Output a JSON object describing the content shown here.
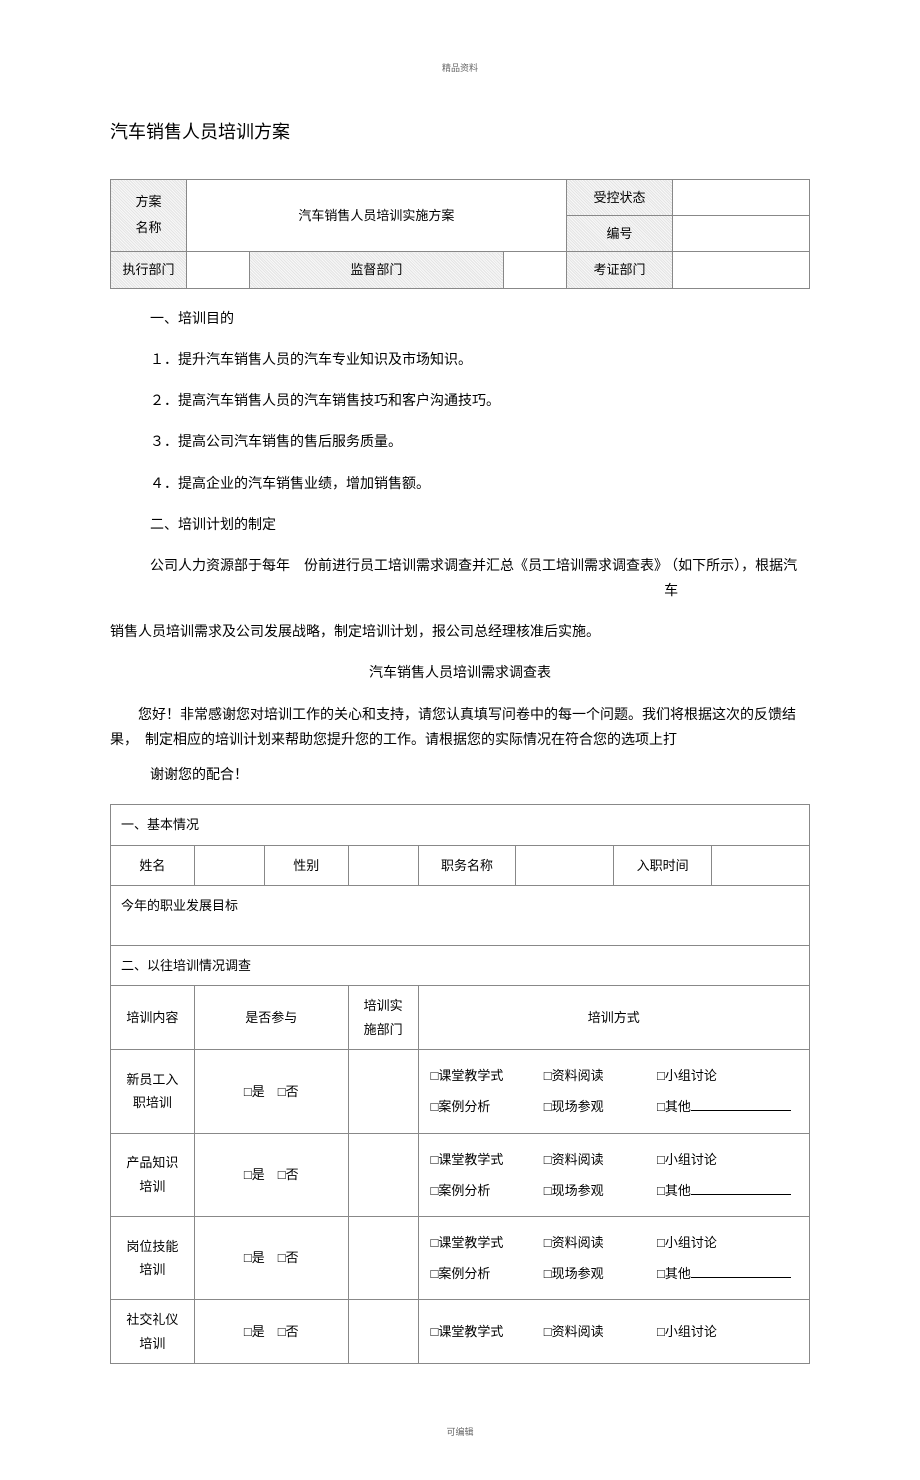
{
  "header_small": "精品资料",
  "title": "汽车销售人员培训方案",
  "header_table": {
    "plan_name_label": "方案\n名称",
    "plan_name_value": "汽车销售人员培训实施方案",
    "status_label": "受控状态",
    "status_value": "",
    "id_label": "编号",
    "id_value": "",
    "exec_dept_label": "执行部门",
    "exec_dept_value": "",
    "supervise_dept_label": "监督部门",
    "supervise_dept_value": "",
    "audit_dept_label": "考证部门",
    "audit_dept_value": ""
  },
  "sec1": {
    "heading": "一、培训目的",
    "p1": "１．提升汽车销售人员的汽车专业知识及市场知识。",
    "p2": "２．提高汽车销售人员的汽车销售技巧和客户沟通技巧。",
    "p3": "３．提高公司汽车销售的售后服务质量。",
    "p4": "４．提高企业的汽车销售业绩，增加销售额。"
  },
  "sec2": {
    "heading": "二、培训计划的制定",
    "p1_a": "公司人力资源部于每年　份前进行员工培训需求调查并汇总《员工培训需求调查表》",
    "p1_b": "（如下所示），根据汽车",
    "p2": "销售人员培训需求及公司发展战略，制定培训计划，报公司总经理核准后实施。",
    "survey_title": "汽车销售人员培训需求调查表",
    "intro1": "您好！非常感谢您对培训工作的关心和支持，请您认真填写问卷中的每一个问题。我们将根据这次的反馈结果，　制定相应的培训计划来帮助您提升您的工作。请根据您的实际情况在符合您的选项上打",
    "thanks": "谢谢您的配合！"
  },
  "survey": {
    "sec1_heading": "一、基本情况",
    "name_label": "姓名",
    "name_value": "",
    "gender_label": "性别",
    "gender_value": "",
    "position_label": "职务名称",
    "position_value": "",
    "entry_label": "入职时间",
    "entry_value": "",
    "goal_label": "今年的职业发展目标",
    "goal_value": "",
    "sec2_heading": "二、以往培训情况调查",
    "col_content": "培训内容",
    "col_attend": "是否参与",
    "col_dept": "培训实施部门",
    "col_method": "培训方式",
    "rows": [
      {
        "content": "新员工入职培训"
      },
      {
        "content": "产品知识培训"
      },
      {
        "content": "岗位技能培训"
      },
      {
        "content": "社交礼仪培训"
      }
    ],
    "yes": "□是",
    "no": "□否",
    "m1": "□课堂教学式",
    "m2": "□资料阅读",
    "m3": "□小组讨论",
    "m4": "□案例分析",
    "m5": "□现场参观",
    "m6": "□其他"
  },
  "footer_small": "可编辑"
}
